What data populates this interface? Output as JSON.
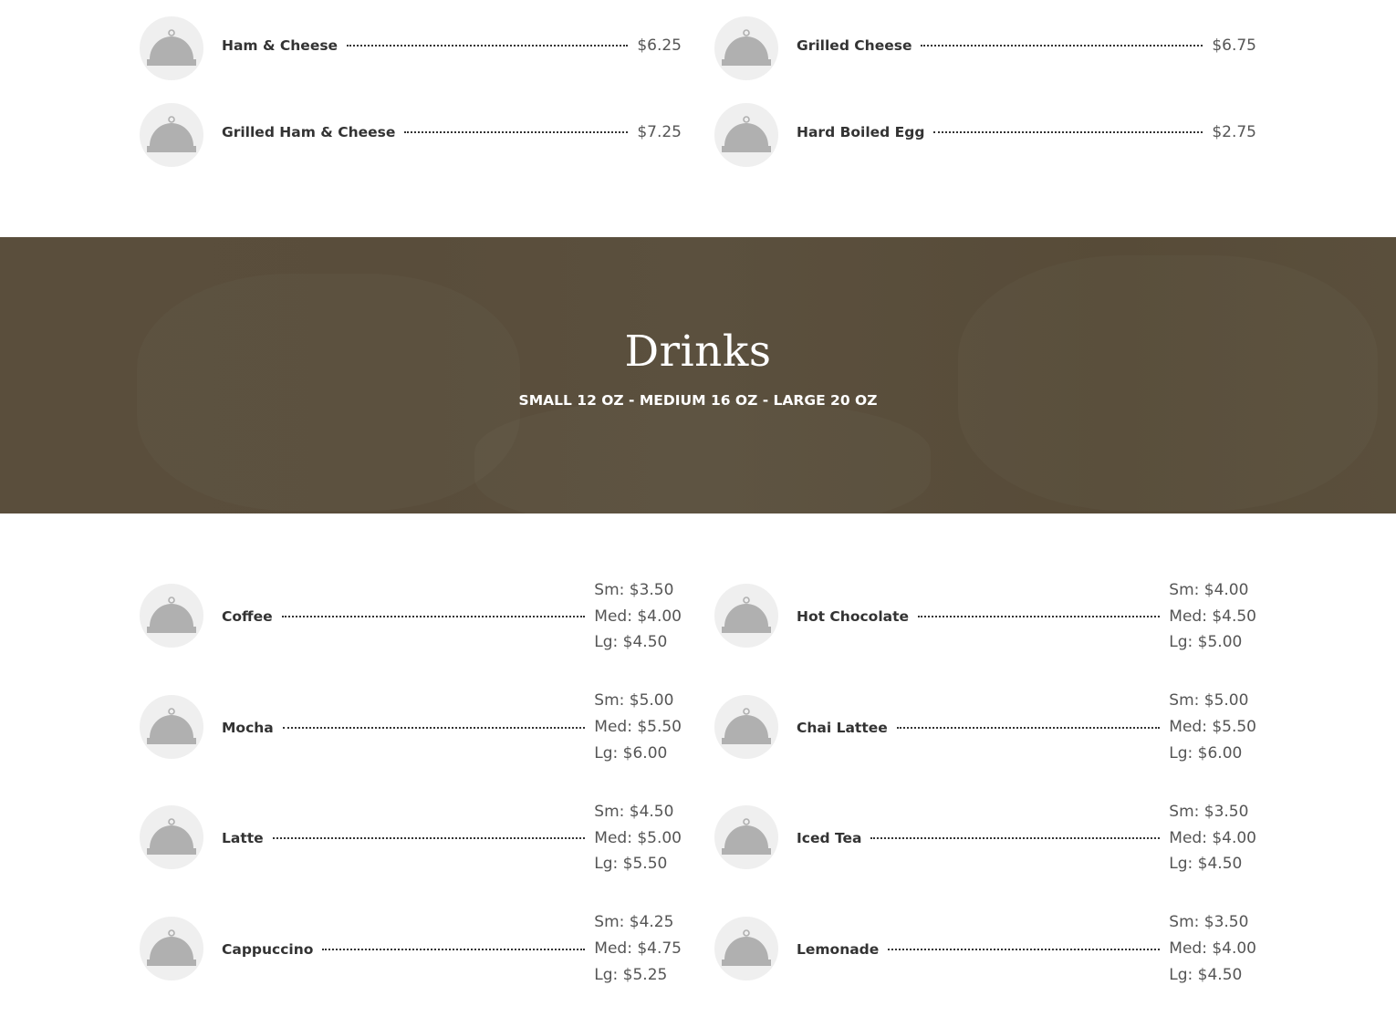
{
  "food_items": [
    {
      "name": "Ham & Cheese",
      "price": "$6.25"
    },
    {
      "name": "Grilled Cheese",
      "price": "$6.75"
    },
    {
      "name": "Grilled Ham & Cheese",
      "price": "$7.25"
    },
    {
      "name": "Hard Boiled Egg",
      "price": "$2.75"
    }
  ],
  "hero": {
    "title": "Drinks",
    "subtitle": "SMALL 12 OZ - MEDIUM 16 OZ - LARGE 20 OZ"
  },
  "drink_items": [
    {
      "name": "Coffee",
      "sm": "Sm: $3.50",
      "med": "Med: $4.00",
      "lg": "Lg: $4.50"
    },
    {
      "name": "Hot Chocolate",
      "sm": "Sm: $4.00",
      "med": "Med: $4.50",
      "lg": "Lg: $5.00"
    },
    {
      "name": "Mocha",
      "sm": "Sm: $5.00",
      "med": "Med: $5.50",
      "lg": "Lg: $6.00"
    },
    {
      "name": "Chai Lattee",
      "sm": "Sm: $5.00",
      "med": "Med: $5.50",
      "lg": "Lg: $6.00"
    },
    {
      "name": "Latte",
      "sm": "Sm: $4.50",
      "med": "Med: $5.00",
      "lg": "Lg: $5.50"
    },
    {
      "name": "Iced Tea",
      "sm": "Sm: $3.50",
      "med": "Med: $4.00",
      "lg": "Lg: $4.50"
    },
    {
      "name": "Cappuccino",
      "sm": "Sm: $4.25",
      "med": "Med: $4.75",
      "lg": "Lg: $5.25"
    },
    {
      "name": "Lemonade",
      "sm": "Sm: $3.50",
      "med": "Med: $4.00",
      "lg": "Lg: $4.50"
    }
  ],
  "icons": {
    "placeholder": "food-cloche-icon",
    "cloche_color": "#b0b0b0",
    "circle_color": "#efefef"
  },
  "colors": {
    "hero_bg": "#5a4e3c",
    "leader": "#333333"
  }
}
